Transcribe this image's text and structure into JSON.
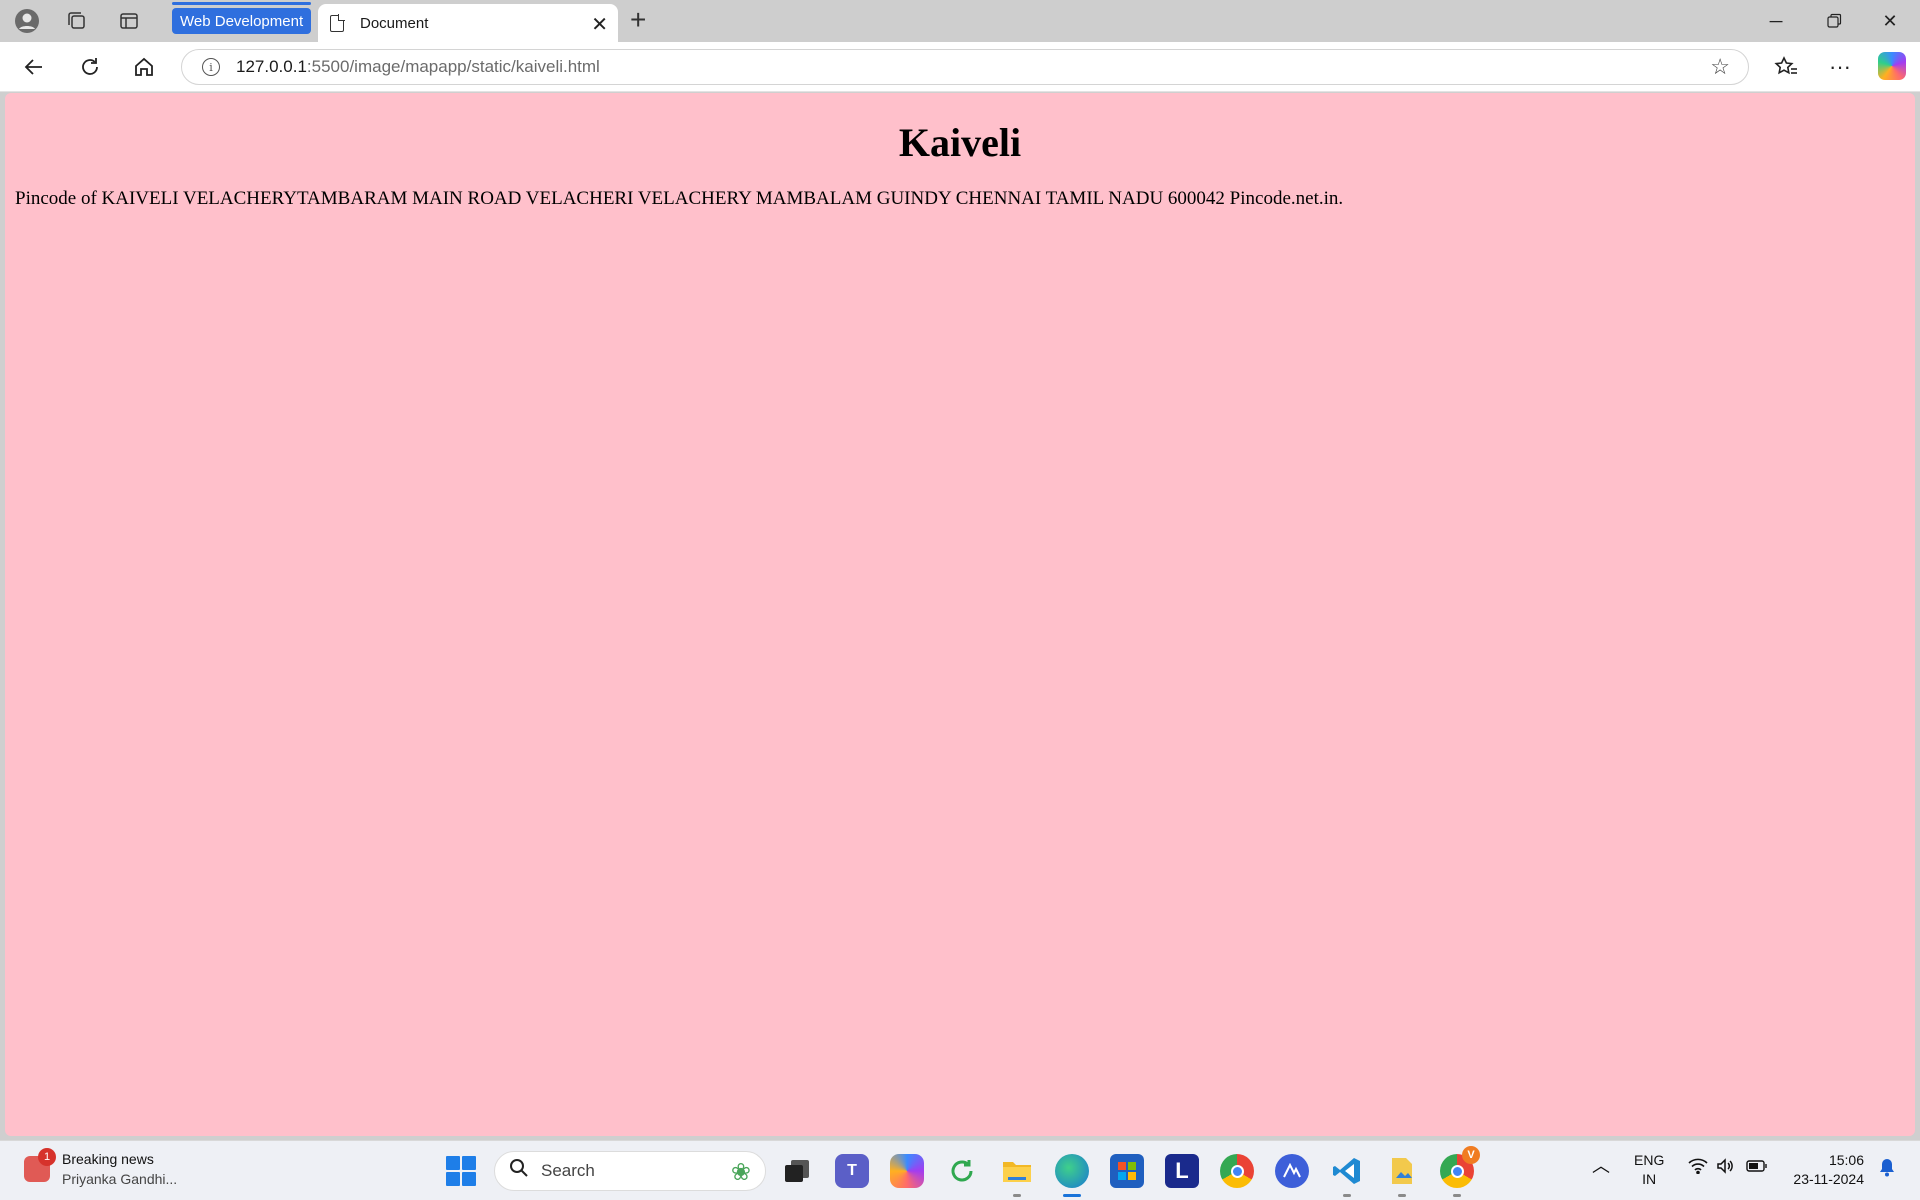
{
  "browser": {
    "tab_group_label": "Web Development",
    "active_tab_title": "Document",
    "url_host": "127.0.0.1",
    "url_path": ":5500/image/mapapp/static/kaiveli.html"
  },
  "page": {
    "background": "#ffc0cb",
    "heading": "Kaiveli",
    "body_text": "Pincode of KAIVELI VELACHERYTAMBARAM MAIN ROAD VELACHERI VELACHERY MAMBALAM GUINDY CHENNAI TAMIL NADU 600042 Pincode.net.in."
  },
  "taskbar": {
    "news_badge": "1",
    "news_title": "Breaking news",
    "news_subtitle": "Priyanka Gandhi...",
    "search_placeholder": "Search",
    "chrome_badge": "V",
    "language_line1": "ENG",
    "language_line2": "IN",
    "time": "15:06",
    "date": "23-11-2024"
  },
  "colors": {
    "accent": "#2f6fde",
    "page_bg": "#ffc0cb",
    "taskbar_bg": "#eef0f5"
  }
}
